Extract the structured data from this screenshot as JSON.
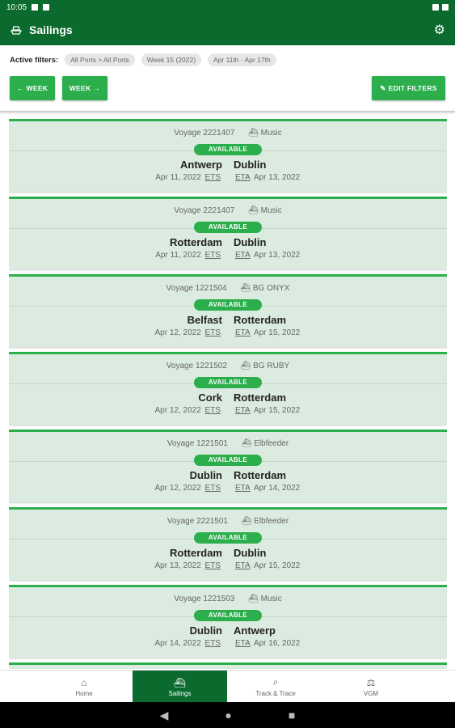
{
  "status_bar": {
    "time": "10:05"
  },
  "app": {
    "title": "Sailings"
  },
  "filters": {
    "label": "Active filters:",
    "chips": [
      "All Ports > All Ports",
      "Week 15 (2022)",
      "Apr 11th - Apr 17th"
    ]
  },
  "buttons": {
    "prev_week": "WEEK",
    "next_week": "WEEK",
    "edit_filters": "EDIT FILTERS"
  },
  "sailings": [
    {
      "voyage": "Voyage 2221407",
      "ship": "Music",
      "status": "AVAILABLE",
      "from": "Antwerp",
      "to": "Dublin",
      "departure": "Apr 11, 2022",
      "ets": "ETS",
      "eta": "ETA",
      "arrival": "Apr 13, 2022"
    },
    {
      "voyage": "Voyage 2221407",
      "ship": "Music",
      "status": "AVAILABLE",
      "from": "Rotterdam",
      "to": "Dublin",
      "departure": "Apr 11, 2022",
      "ets": "ETS",
      "eta": "ETA",
      "arrival": "Apr 13, 2022"
    },
    {
      "voyage": "Voyage 1221504",
      "ship": "BG ONYX",
      "status": "AVAILABLE",
      "from": "Belfast",
      "to": "Rotterdam",
      "departure": "Apr 12, 2022",
      "ets": "ETS",
      "eta": "ETA",
      "arrival": "Apr 15, 2022"
    },
    {
      "voyage": "Voyage 1221502",
      "ship": "BG RUBY",
      "status": "AVAILABLE",
      "from": "Cork",
      "to": "Rotterdam",
      "departure": "Apr 12, 2022",
      "ets": "ETS",
      "eta": "ETA",
      "arrival": "Apr 15, 2022"
    },
    {
      "voyage": "Voyage 1221501",
      "ship": "Elbfeeder",
      "status": "AVAILABLE",
      "from": "Dublin",
      "to": "Rotterdam",
      "departure": "Apr 12, 2022",
      "ets": "ETS",
      "eta": "ETA",
      "arrival": "Apr 14, 2022"
    },
    {
      "voyage": "Voyage 2221501",
      "ship": "Elbfeeder",
      "status": "AVAILABLE",
      "from": "Rotterdam",
      "to": "Dublin",
      "departure": "Apr 13, 2022",
      "ets": "ETS",
      "eta": "ETA",
      "arrival": "Apr 15, 2022"
    },
    {
      "voyage": "Voyage 1221503",
      "ship": "Music",
      "status": "AVAILABLE",
      "from": "Dublin",
      "to": "Antwerp",
      "departure": "Apr 14, 2022",
      "ets": "ETS",
      "eta": "ETA",
      "arrival": "Apr 16, 2022"
    }
  ],
  "bottom_nav": [
    {
      "label": "Home",
      "icon": "home-icon",
      "active": false
    },
    {
      "label": "Sailings",
      "icon": "ship-icon",
      "active": true
    },
    {
      "label": "Track & Trace",
      "icon": "track-icon",
      "active": false
    },
    {
      "label": "VGM",
      "icon": "vgm-icon",
      "active": false
    }
  ],
  "colors": {
    "primary_dark": "#0b6b2e",
    "accent": "#2cae4d",
    "card_bg": "#dcebdf"
  }
}
